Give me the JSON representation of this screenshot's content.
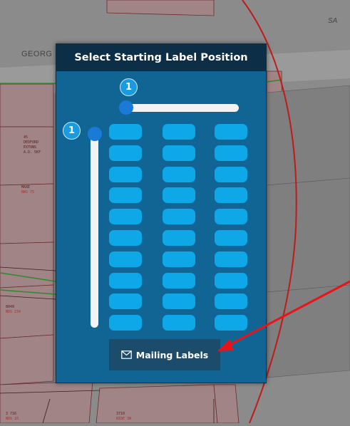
{
  "map": {
    "street_george": "GEORG",
    "street_sa": "SA",
    "parcels": {
      "p1": [
        "45",
        "DEDFORD",
        "EXTONS",
        "A.D. 5KF"
      ],
      "p2": [
        "MAXE",
        "NWS 75"
      ],
      "p3": [
        "3710",
        "NIDE 3W"
      ],
      "p4": [
        "3 778",
        "NOS 75"
      ],
      "p5": [
        "3 716",
        "NDS 10"
      ],
      "p6": [
        "8049",
        "NDS 234"
      ]
    }
  },
  "dialog": {
    "title": "Select Starting Label Position",
    "column_slider": {
      "value": "1"
    },
    "row_slider": {
      "value": "1"
    },
    "grid": {
      "columns": 3,
      "rows": 10
    },
    "button": {
      "label": "Mailing Labels",
      "icon": "envelope-icon"
    }
  },
  "colors": {
    "dialog_bg": "#116594",
    "header_bg": "#0c2e46",
    "cell": "#0ea8e8",
    "thumb": "#1a7ad8",
    "arrow": "#e8141a"
  }
}
